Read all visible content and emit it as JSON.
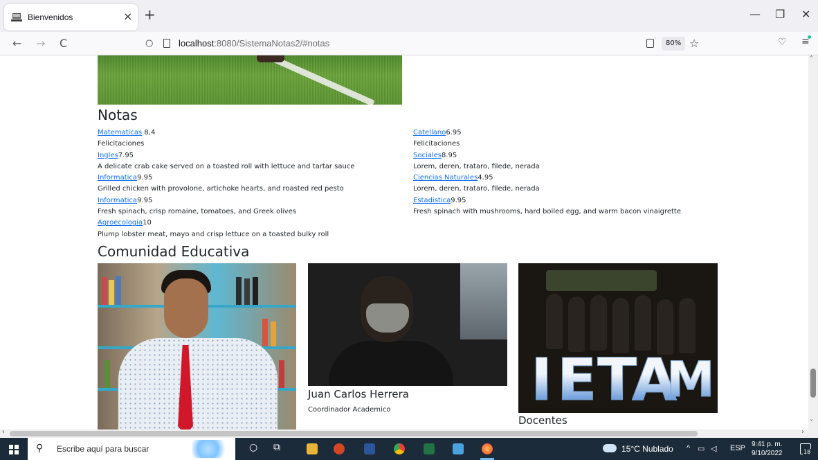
{
  "browser": {
    "tab_title": "Bienvenidos",
    "tab_close": "×",
    "new_tab": "+",
    "url_host": "localhost",
    "url_rest": ":8080/SistemaNotas2/#notas",
    "zoom": "80%",
    "window_controls": {
      "minimize": "—",
      "restore": "❐",
      "close": "✕"
    },
    "nav": {
      "back": "←",
      "forward": "→",
      "reload": "C"
    }
  },
  "page": {
    "notas_title": "Notas",
    "notes_left": [
      {
        "subject": "Matematicas",
        "grade": " 8,4",
        "desc": "Felicitaciones"
      },
      {
        "subject": "Ingles",
        "grade": "7.95",
        "desc": "A delicate crab cake served on a toasted roll with lettuce and tartar sauce"
      },
      {
        "subject": "Informatica",
        "grade": "9.95",
        "desc": "Grilled chicken with provolone, artichoke hearts, and roasted red pesto"
      },
      {
        "subject": "Informatica",
        "grade": "9.95",
        "desc": "Fresh spinach, crisp romaine, tomatoes, and Greek olives"
      },
      {
        "subject": "Agroecologia",
        "grade": "10",
        "desc": "Plump lobster meat, mayo and crisp lettuce on a toasted bulky roll"
      }
    ],
    "notes_right": [
      {
        "subject": "Catellano",
        "grade": "6.95",
        "desc": "Felicitaciones"
      },
      {
        "subject": "Sociales",
        "grade": "8.95",
        "desc": "Lorem, deren, trataro, filede, nerada"
      },
      {
        "subject": "Ciencias Naturales",
        "grade": "4.95",
        "desc": "Lorem, deren, trataro, filede, nerada"
      },
      {
        "subject": "Estadistica",
        "grade": "9.95",
        "desc": "Fresh spinach with mushrooms, hard boiled egg, and warm bacon vinaigrette"
      }
    ],
    "community_title": "Comunidad Educativa",
    "card2_name": "Juan Carlos Herrera",
    "card2_role": "Coordinador Academico",
    "card3_name": "Docentes",
    "card3_letters": [
      "I",
      "E",
      "T",
      "A",
      "M"
    ]
  },
  "taskbar": {
    "search_placeholder": "Escribe aquí para buscar",
    "weather": "15°C  Nublado",
    "lang": "ESP",
    "time": "9:41 p. m.",
    "date": "9/10/2022",
    "notifications": "18"
  },
  "colors": {
    "link": "#0d6efd",
    "taskbar": "#1c2b3a",
    "tie": "#d0182a"
  }
}
